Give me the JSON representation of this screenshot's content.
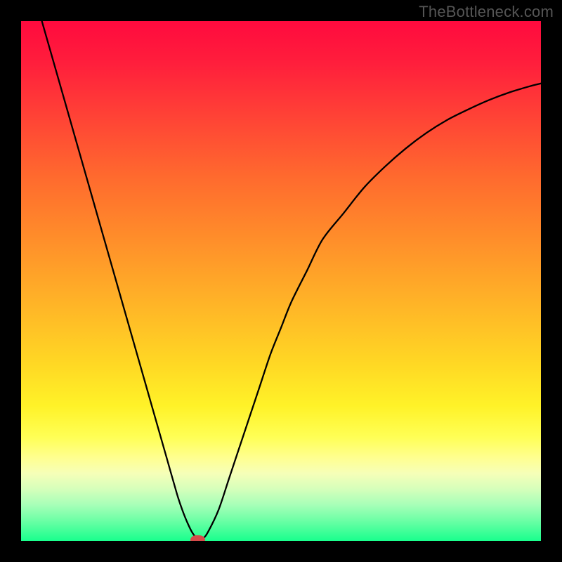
{
  "watermark": "TheBottleneck.com",
  "chart_data": {
    "type": "line",
    "title": "",
    "xlabel": "",
    "ylabel": "",
    "xlim": [
      0,
      100
    ],
    "ylim": [
      0,
      100
    ],
    "gradient_stops": [
      {
        "pct": 0,
        "color": "#ff0a3e"
      },
      {
        "pct": 8,
        "color": "#ff1e3c"
      },
      {
        "pct": 18,
        "color": "#ff4136"
      },
      {
        "pct": 30,
        "color": "#ff6a2e"
      },
      {
        "pct": 42,
        "color": "#ff8e2a"
      },
      {
        "pct": 55,
        "color": "#ffb627"
      },
      {
        "pct": 66,
        "color": "#ffd824"
      },
      {
        "pct": 74,
        "color": "#fff228"
      },
      {
        "pct": 80,
        "color": "#ffff55"
      },
      {
        "pct": 84,
        "color": "#ffff90"
      },
      {
        "pct": 87,
        "color": "#f6ffb8"
      },
      {
        "pct": 90,
        "color": "#d6ffbb"
      },
      {
        "pct": 93,
        "color": "#a8ffb8"
      },
      {
        "pct": 96,
        "color": "#6effa6"
      },
      {
        "pct": 100,
        "color": "#19ff8d"
      }
    ],
    "series": [
      {
        "name": "curve",
        "x": [
          4,
          6,
          8,
          10,
          12,
          14,
          16,
          18,
          20,
          22,
          24,
          26,
          28,
          30,
          31,
          32,
          33,
          34,
          35,
          36,
          38,
          40,
          42,
          44,
          46,
          48,
          50,
          52,
          55,
          58,
          62,
          66,
          70,
          74,
          78,
          82,
          86,
          90,
          94,
          98,
          100
        ],
        "y": [
          100,
          93,
          86,
          79,
          72,
          65,
          58,
          51,
          44,
          37,
          30,
          23,
          16,
          9,
          6,
          3.5,
          1.5,
          0.4,
          0.5,
          1.8,
          6,
          12,
          18,
          24,
          30,
          36,
          41,
          46,
          52,
          58,
          63,
          68,
          72,
          75.5,
          78.5,
          81,
          83,
          84.8,
          86.3,
          87.5,
          88
        ]
      }
    ],
    "marker": {
      "x": 34,
      "y": 0.2,
      "rx": 1.4,
      "ry": 0.9
    },
    "colors": {
      "background": "#000000",
      "curve": "#000000",
      "marker": "#d64a4a",
      "watermark": "#555555"
    }
  }
}
